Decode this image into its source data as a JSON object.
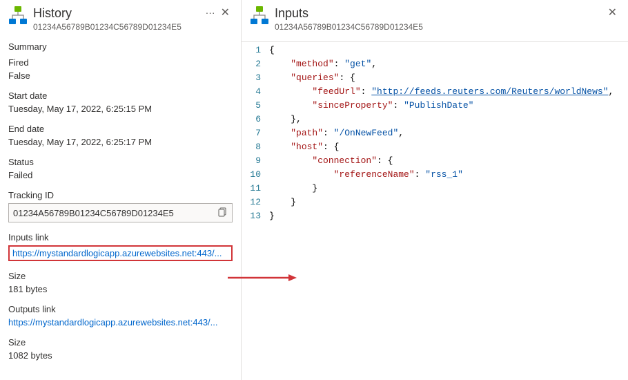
{
  "history": {
    "title": "History",
    "subtitle": "01234A56789B01234C56789D01234E5",
    "summary_heading": "Summary",
    "fired_label": "Fired",
    "fired_value": "False",
    "start_label": "Start date",
    "start_value": "Tuesday, May 17, 2022, 6:25:15 PM",
    "end_label": "End date",
    "end_value": "Tuesday, May 17, 2022, 6:25:17 PM",
    "status_label": "Status",
    "status_value": "Failed",
    "tracking_label": "Tracking ID",
    "tracking_value": "01234A56789B01234C56789D01234E5",
    "inputs_link_label": "Inputs link",
    "inputs_link_value": "https://mystandardlogicapp.azurewebsites.net:443/...",
    "inputs_size_label": "Size",
    "inputs_size_value": "181 bytes",
    "outputs_link_label": "Outputs link",
    "outputs_link_value": "https://mystandardlogicapp.azurewebsites.net:443/...",
    "outputs_size_label": "Size",
    "outputs_size_value": "1082 bytes"
  },
  "inputs": {
    "title": "Inputs",
    "subtitle": "01234A56789B01234C56789D01234E5",
    "json": {
      "method": "get",
      "queries": {
        "feedUrl": "http://feeds.reuters.com/Reuters/worldNews",
        "sinceProperty": "PublishDate"
      },
      "path": "/OnNewFeed",
      "host": {
        "connection": {
          "referenceName": "rss_1"
        }
      }
    }
  }
}
